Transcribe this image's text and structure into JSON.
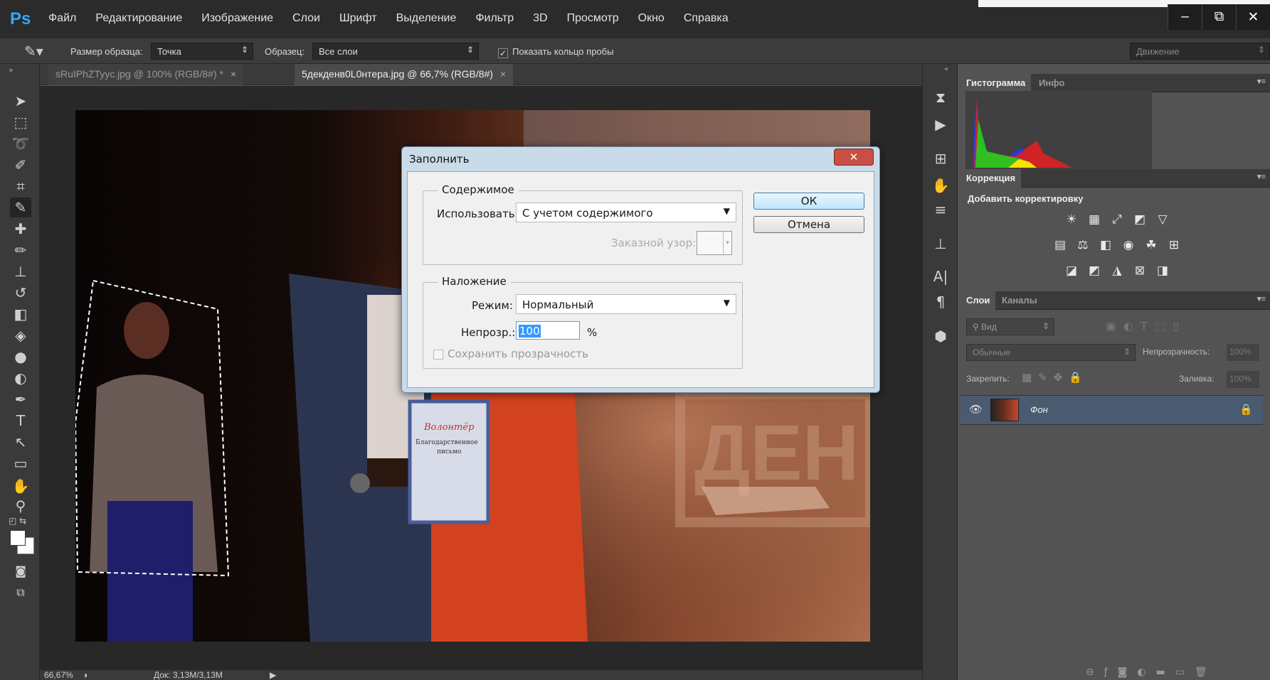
{
  "app": {
    "logo": "Ps"
  },
  "menu": [
    "Файл",
    "Редактирование",
    "Изображение",
    "Слои",
    "Шрифт",
    "Выделение",
    "Фильтр",
    "3D",
    "Просмотр",
    "Окно",
    "Справка"
  ],
  "window_buttons": [
    "–",
    "⧉",
    "✕"
  ],
  "options": {
    "sample_size_label": "Размер образца:",
    "sample_size_value": "Точка",
    "sample_label": "Образец:",
    "sample_value": "Все слои",
    "show_ring_label": "Показать кольцо пробы",
    "workspace": "Движение"
  },
  "tabs": [
    {
      "label": "sRuIPhZTyyc.jpg @ 100% (RGB/8#) *",
      "close": "×"
    },
    {
      "label": "5декденв0L0нтера.jpg @ 66,7% (RGB/8#)",
      "close": "×"
    }
  ],
  "status": {
    "zoom": "66,67%",
    "doc": "Док: 3,13M/3,13M"
  },
  "photo_texts": {
    "cert_brand": "Волонтёр",
    "cert_line1": "Благодарственное",
    "cert_line2": "письмо",
    "wall_text": "ДЕН"
  },
  "panels": {
    "histogram_tab": "Гистограмма",
    "info_tab": "Инфо",
    "correction_tab": "Коррекция",
    "add_correction": "Добавить корректировку",
    "layers_tab": "Слои",
    "channels_tab": "Каналы",
    "filter_kind": "Вид",
    "blend_mode": "Обычные",
    "opacity_label": "Непрозрачность:",
    "opacity_value": "100%",
    "lock_label": "Закрепить:",
    "fill_label": "Заливка:",
    "fill_value": "100%",
    "layer_name": "Фон"
  },
  "dialog": {
    "title": "Заполнить",
    "close": "✕",
    "content_group": "Содержимое",
    "use_label": "Использовать:",
    "use_value": "С учетом содержимого",
    "pattern_label": "Заказной узор:",
    "blend_group": "Наложение",
    "mode_label": "Режим:",
    "mode_value": "Нормальный",
    "opacity_label": "Непрозр.:",
    "opacity_value": "100",
    "percent": "%",
    "preserve_label": "Сохранить прозрачность",
    "ok": "ОК",
    "cancel": "Отмена"
  },
  "colors": {
    "accent": "#31a8ff",
    "chrome_dark": "#2b2b2b",
    "dialog_frame": "#c9dbe9"
  }
}
